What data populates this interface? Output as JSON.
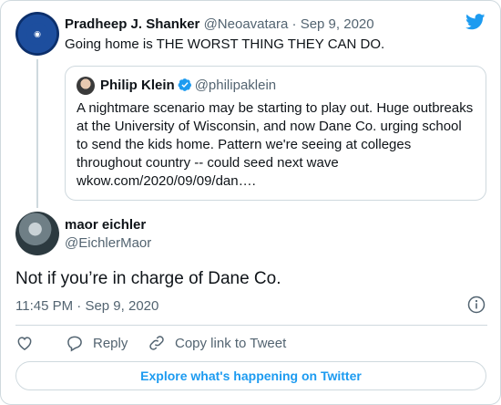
{
  "original_tweet": {
    "author_name": "Pradheep J. Shanker",
    "author_handle": "@Neoavatara",
    "separator": " · ",
    "date": "Sep 9, 2020",
    "text": "Going home is THE WORST THING THEY CAN DO.",
    "avatar_icon": "logo-avatar"
  },
  "quoted_tweet": {
    "author_name": "Philip Klein",
    "author_handle": "@philipaklein",
    "verified_icon": "verified-badge-icon",
    "lines": [
      "A nightmare scenario may be starting to play out. Huge outbreaks",
      "at the University of Wisconsin, and now Dane Co. urging school",
      "to send the kids home. Pattern we're seeing at colleges",
      "throughout country -- could seed next wave",
      "wkow.com/2020/09/09/dan…."
    ]
  },
  "reply_tweet": {
    "author_name": "maor eichler",
    "author_handle": "@EichlerMaor",
    "text": "Not if you’re in charge of Dane Co.",
    "time": "11:45 PM",
    "separator": " · ",
    "date": "Sep 9, 2020"
  },
  "actions": {
    "reply_label": "Reply",
    "copy_link_label": "Copy link to Tweet"
  },
  "explore_label": "Explore what's happening on Twitter",
  "colors": {
    "twitter_blue": "#1d9bf0",
    "text_primary": "#0f1419",
    "text_secondary": "#536471",
    "border": "#cfd9de"
  }
}
